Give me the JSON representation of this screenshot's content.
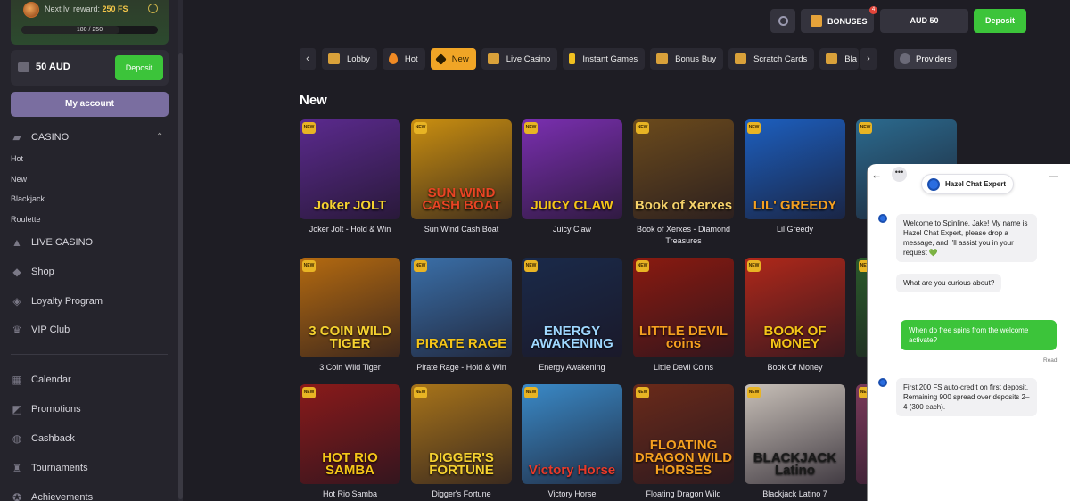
{
  "sidebar": {
    "reward_prefix": "Next lvl reward:",
    "reward_value": "250 FS",
    "reward_progress_label": "180 / 250",
    "reward_progress_fraction": 0.72,
    "balance": "50 AUD",
    "deposit_label": "Deposit",
    "account_label": "My account",
    "casino_label": "CASINO",
    "casino_subitems": [
      "Hot",
      "New",
      "Blackjack",
      "Roulette"
    ],
    "items": [
      {
        "label": "LIVE CASINO",
        "icon": "live-casino-icon"
      },
      {
        "label": "Shop",
        "icon": "shop-icon"
      },
      {
        "label": "Loyalty Program",
        "icon": "loyalty-icon"
      },
      {
        "label": "VIP Club",
        "icon": "crown-icon"
      }
    ],
    "items2": [
      {
        "label": "Calendar",
        "icon": "calendar-icon"
      },
      {
        "label": "Promotions",
        "icon": "promotions-icon"
      },
      {
        "label": "Cashback",
        "icon": "cashback-icon"
      },
      {
        "label": "Tournaments",
        "icon": "trophy-icon"
      },
      {
        "label": "Achievements",
        "icon": "achievements-icon"
      }
    ]
  },
  "topbar": {
    "bonuses_label": "BONUSES",
    "bonuses_badge": "4",
    "balance_label": "AUD 50",
    "deposit_label": "Deposit"
  },
  "categories": [
    {
      "label": "Lobby",
      "color": "#d9a13a"
    },
    {
      "label": "Hot",
      "color": "#f08a24"
    },
    {
      "label": "New",
      "color": "#2a1d00",
      "active": true
    },
    {
      "label": "Live Casino",
      "color": "#d9a13a"
    },
    {
      "label": "Instant Games",
      "color": "#f0c020"
    },
    {
      "label": "Bonus Buy",
      "color": "#d9a13a"
    },
    {
      "label": "Scratch Cards",
      "color": "#d9a13a"
    },
    {
      "label": "Bla",
      "color": "#d9a13a"
    }
  ],
  "providers_label": "Providers",
  "section_title": "New",
  "new_badge": "NEW",
  "games": [
    {
      "name": "Joker Jolt - Hold & Win",
      "art": "Joker JOLT",
      "bg": "#5b2a8e",
      "fg": "#f5d130"
    },
    {
      "name": "Sun Wind Cash Boat",
      "art": "SUN WIND CASH BOAT",
      "bg": "#c98e10",
      "fg": "#e84424"
    },
    {
      "name": "Juicy Claw",
      "art": "JUICY CLAW",
      "bg": "#7a2fb0",
      "fg": "#f5c518"
    },
    {
      "name": "Book of Xerxes - Diamond Treasures",
      "art": "Book of Xerxes",
      "bg": "#6b4a1c",
      "fg": "#f5d26a"
    },
    {
      "name": "Lil Greedy",
      "art": "LIL' GREEDY",
      "bg": "#1c5fbf",
      "fg": "#f5a020"
    },
    {
      "name": "",
      "art": "",
      "bg": "#2b6a8e",
      "fg": "#f5c518"
    },
    {
      "name": "3 Coin Wild Tiger",
      "art": "3 COIN WILD TIGER",
      "bg": "#b46a10",
      "fg": "#f5d130"
    },
    {
      "name": "Pirate Rage - Hold & Win",
      "art": "PIRATE RAGE",
      "bg": "#3a6fa8",
      "fg": "#f5c518"
    },
    {
      "name": "Energy Awakening",
      "art": "ENERGY AWAKENING",
      "bg": "#1a2a4a",
      "fg": "#9fd8ff"
    },
    {
      "name": "Little Devil Coins",
      "art": "LITTLE DEVIL coins",
      "bg": "#8a1a10",
      "fg": "#f5a020"
    },
    {
      "name": "Book Of Money",
      "art": "BOOK OF MONEY",
      "bg": "#b0281a",
      "fg": "#f5c518"
    },
    {
      "name": "",
      "art": "",
      "bg": "#2a5a2a",
      "fg": "#f5c518"
    },
    {
      "name": "Hot Rio Samba",
      "art": "HOT RIO SAMBA",
      "bg": "#8a1a1a",
      "fg": "#f5c518"
    },
    {
      "name": "Digger's Fortune",
      "art": "DIGGER'S FORTUNE",
      "bg": "#a8741a",
      "fg": "#f5d130"
    },
    {
      "name": "Victory Horse",
      "art": "Victory Horse",
      "bg": "#3a8ac8",
      "fg": "#e83a2a"
    },
    {
      "name": "Floating Dragon Wild",
      "art": "FLOATING DRAGON WILD HORSES",
      "bg": "#6a2a1a",
      "fg": "#f5a020"
    },
    {
      "name": "Blackjack Latino 7",
      "art": "BLACKJACK Latino",
      "bg": "#c8c0b8",
      "fg": "#1a1a1a"
    },
    {
      "name": "",
      "art": "",
      "bg": "#7a3a5a",
      "fg": "#f5c518"
    }
  ],
  "chat": {
    "agent_name": "Hazel Chat Expert",
    "welcome": "Welcome to Spinline, Jake! My name is Hazel Chat Expert, please drop a message, and I'll assist you in your request 💚",
    "prompt": "What are you curious about?",
    "user_msg": "When do free spins from the welcome activate?",
    "read": "Read",
    "reply": "First 200 FS auto-credit on first deposit. Remaining 900 spread over deposits 2–4 (300 each)."
  }
}
